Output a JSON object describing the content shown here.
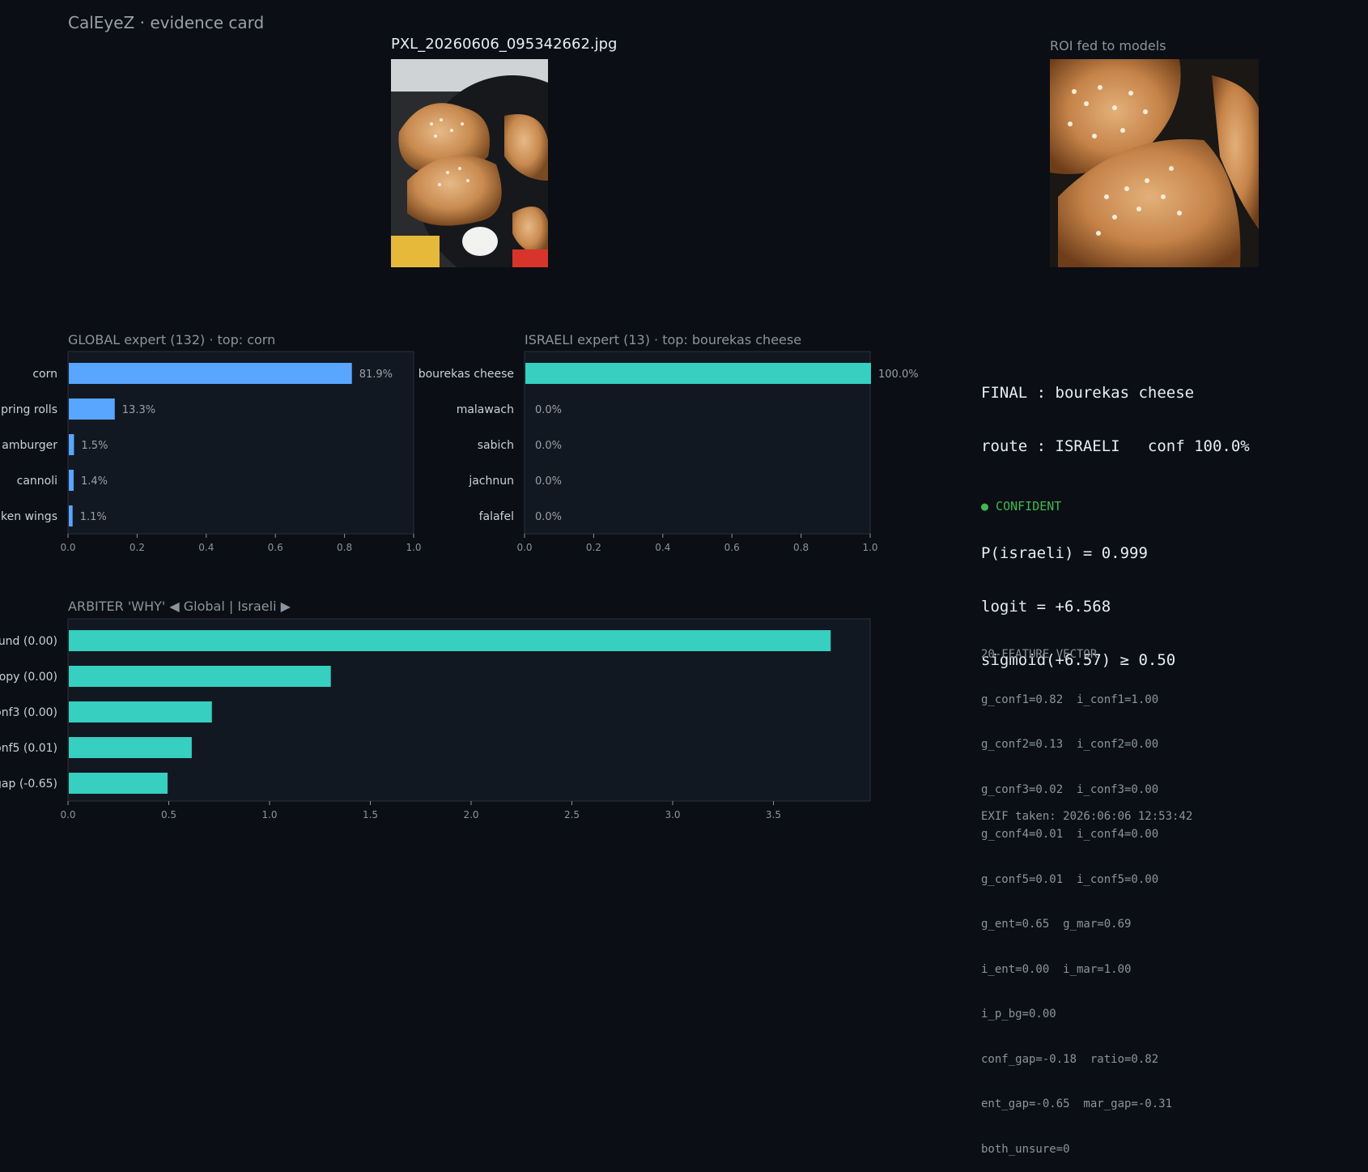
{
  "app": {
    "title": "CalEyeZ · evidence card"
  },
  "image": {
    "filename": "PXL_20260606_095342662.jpg",
    "roi_label": "ROI fed to models"
  },
  "global_panel": {
    "title": "GLOBAL expert (132)  ·  top: corn"
  },
  "israeli_panel": {
    "title": "ISRAELI expert (13)  ·  top: bourekas cheese"
  },
  "arbiter_panel": {
    "title": "ARBITER 'WHY'   ◀ Global   |   Israeli ▶"
  },
  "chart_data": [
    {
      "type": "bar",
      "orientation": "horizontal",
      "title": "GLOBAL expert (132)  ·  top: corn",
      "categories": [
        "corn",
        "spring rolls",
        "hamburger",
        "cannoli",
        "chicken wings"
      ],
      "visible_category_labels": [
        "corn",
        "pring rolls",
        "amburger",
        "cannoli",
        "ken wings"
      ],
      "values": [
        0.819,
        0.133,
        0.015,
        0.014,
        0.011
      ],
      "value_labels": [
        "81.9%",
        "13.3%",
        "1.5%",
        "1.4%",
        "1.1%"
      ],
      "xlim": [
        0,
        1.0
      ],
      "xticks": [
        "0.0",
        "0.2",
        "0.4",
        "0.6",
        "0.8",
        "1.0"
      ],
      "color": "#58a6ff"
    },
    {
      "type": "bar",
      "orientation": "horizontal",
      "title": "ISRAELI expert (13)  ·  top: bourekas cheese",
      "categories": [
        "bourekas cheese",
        "malawach",
        "sabich",
        "jachnun",
        "falafel"
      ],
      "values": [
        1.0,
        0.0,
        0.0,
        0.0,
        0.0
      ],
      "value_labels": [
        "100.0%",
        "0.0%",
        "0.0%",
        "0.0%",
        "0.0%"
      ],
      "xlim": [
        0,
        1.0
      ],
      "xticks": [
        "0.0",
        "0.2",
        "0.4",
        "0.6",
        "0.8",
        "1.0"
      ],
      "color": "#36cfc0"
    },
    {
      "type": "bar",
      "orientation": "horizontal",
      "title": "ARBITER 'WHY'   ◀ Global   |   Israeli ▶",
      "visible_category_labels": [
        "und (0.00)",
        "ropy (0.00)",
        "onf3 (0.00)",
        "onf5 (0.01)",
        "gap (-0.65)"
      ],
      "values": [
        3.78,
        1.3,
        0.71,
        0.61,
        0.49
      ],
      "xlim": [
        0,
        3.98
      ],
      "xticks": [
        "0.0",
        "0.5",
        "1.0",
        "1.5",
        "2.0",
        "2.5",
        "3.0",
        "3.5"
      ],
      "color": "#36cfc0"
    }
  ],
  "final": {
    "lines": [
      "FINAL : bourekas cheese",
      "route : ISRAELI   conf 100.0%",
      "",
      "P(israeli) = 0.999",
      "logit = +6.568",
      "sigmoid(+6.57) ≥ 0.50"
    ],
    "status": "● CONFIDENT",
    "status_color": "#3fb950"
  },
  "features": {
    "title": "20-FEATURE VECTOR",
    "lines": [
      "g_conf1=0.82  i_conf1=1.00",
      "g_conf2=0.13  i_conf2=0.00",
      "g_conf3=0.02  i_conf3=0.00",
      "g_conf4=0.01  i_conf4=0.00",
      "g_conf5=0.01  i_conf5=0.00",
      "g_ent=0.65  g_mar=0.69",
      "i_ent=0.00  i_mar=1.00",
      "i_p_bg=0.00",
      "conf_gap=-0.18  ratio=0.82",
      "ent_gap=-0.65  mar_gap=-0.31",
      "both_unsure=0"
    ]
  },
  "exif": {
    "text": "EXIF taken: 2026:06:06 12:53:42"
  }
}
